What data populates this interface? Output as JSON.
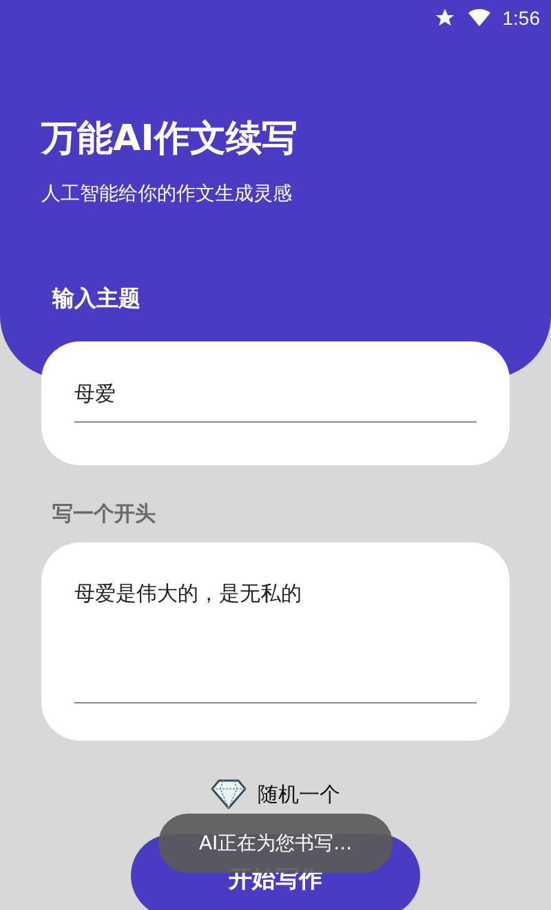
{
  "status_bar": {
    "time": "1:56"
  },
  "header": {
    "title": "万能AI作文续写",
    "subtitle": "人工智能给你的作文生成灵感"
  },
  "topic": {
    "label": "输入主题",
    "value": "母爱"
  },
  "opening": {
    "label": "写一个开头",
    "value": "母爱是伟大的，是无私的"
  },
  "random_button": {
    "label": "随机一个"
  },
  "start_button": {
    "label": "开始写作"
  },
  "toast": {
    "text": "AI正在为您书写..."
  }
}
